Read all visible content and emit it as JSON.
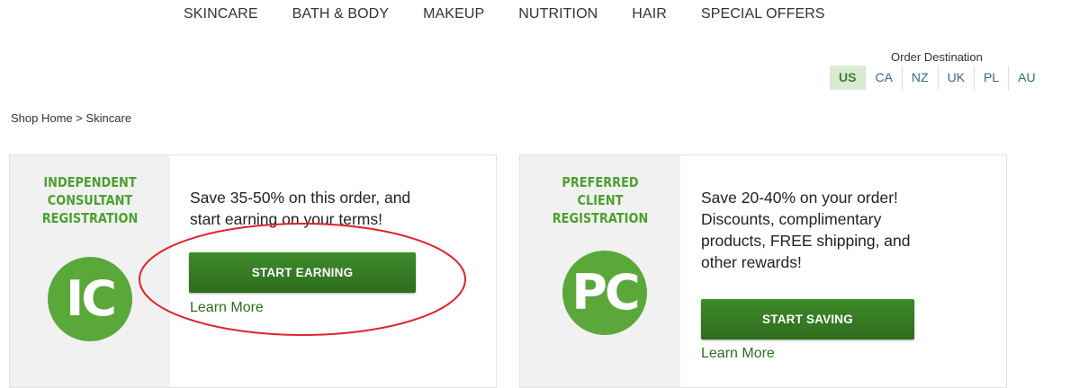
{
  "topnav": {
    "items": [
      "SKINCARE",
      "BATH & BODY",
      "MAKEUP",
      "NUTRITION",
      "HAIR",
      "SPECIAL OFFERS"
    ]
  },
  "order_destination": {
    "label": "Order Destination",
    "countries": [
      "US",
      "CA",
      "NZ",
      "UK",
      "PL",
      "AU"
    ],
    "selected": "US"
  },
  "breadcrumb": {
    "home": "Shop Home",
    "separator": ">",
    "current": "Skincare"
  },
  "cards": {
    "consultant": {
      "title_line1": "INDEPENDENT",
      "title_line2": "CONSULTANT",
      "title_line3": "REGISTRATION",
      "badge": "IC",
      "promo_line1": "Save 35-50% on this order, and",
      "promo_line2": "start earning on your terms!",
      "cta": "START EARNING",
      "learn_more": "Learn More"
    },
    "client": {
      "title_line1": "PREFERRED",
      "title_line2": "CLIENT",
      "title_line3": "REGISTRATION",
      "badge": "PC",
      "promo_line1": "Save 20-40% on your order!",
      "promo_line2": "Discounts, complimentary",
      "promo_line3": "products, FREE shipping, and",
      "promo_line4": "other rewards!",
      "cta": "START SAVING",
      "learn_more": "Learn More"
    }
  },
  "colors": {
    "brand_green": "#4ea030",
    "button_green": "#3a7d27",
    "badge_green": "#5ba83a",
    "annotation_red": "#e0222a",
    "selected_country_bg": "#d9ead3"
  }
}
